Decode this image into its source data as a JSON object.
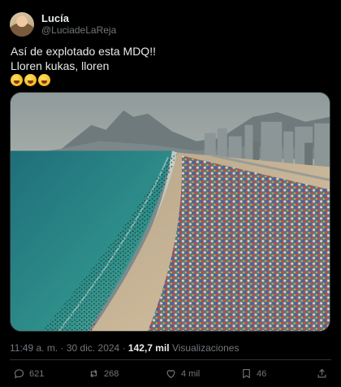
{
  "author": {
    "display_name": "Lucía",
    "handle": "@LuciadeLaReja"
  },
  "tweet": {
    "lines": [
      "Así de explotado esta MDQ!!",
      "Lloren kukas, lloren"
    ],
    "emojis": [
      "grinning-tongue-emoji",
      "grinning-tongue-emoji",
      "rolling-laughing-emoji"
    ]
  },
  "meta": {
    "time": "11:49 a. m.",
    "separator": "·",
    "date": "30 dic. 2024",
    "views_count": "142,7 mil",
    "views_label": "Visualizaciones"
  },
  "actions": {
    "replies": "621",
    "reposts": "268",
    "likes": "4 mil",
    "bookmarks": "46"
  },
  "colors": {
    "background": "#000000",
    "text": "#e7e9ea",
    "muted": "#71767b",
    "divider": "#2f3336"
  }
}
